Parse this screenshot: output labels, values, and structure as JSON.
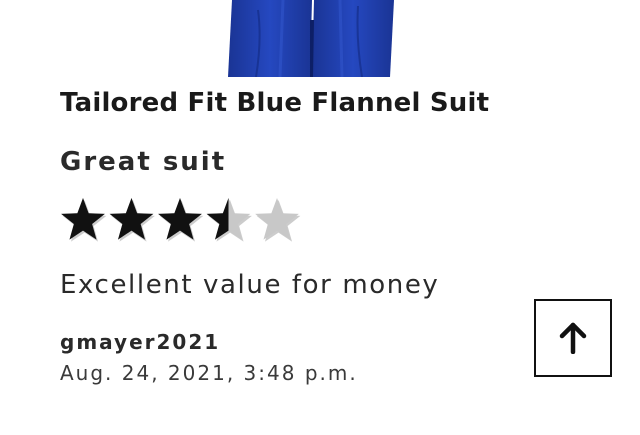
{
  "product": {
    "title": "Tailored Fit Blue Flannel Suit",
    "image_color": "#1f3ea8"
  },
  "review": {
    "title": "Great suit",
    "rating": 3.5,
    "rating_max": 5,
    "star_filled_color": "#111111",
    "star_empty_color": "#c8c8c8",
    "body": "Excellent value for money",
    "reviewer": "gmayer2021",
    "date": "Aug. 24, 2021, 3:48 p.m."
  },
  "back_to_top": {
    "icon": "arrow-up-icon"
  }
}
